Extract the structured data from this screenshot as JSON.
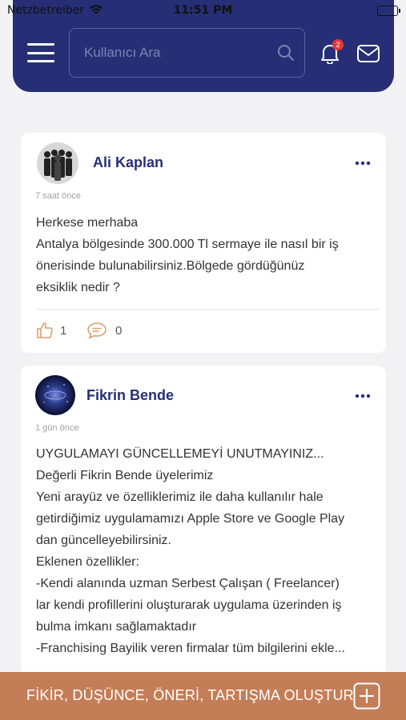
{
  "status_bar": {
    "carrier": "Netzbetreiber",
    "time": "11:51 PM"
  },
  "header": {
    "search_placeholder": "Kullanıcı Ara",
    "notification_count": "2",
    "brand_color": "#262f75"
  },
  "posts": [
    {
      "author": "Ali Kaplan",
      "time_ago": "7 saat önce",
      "lines": [
        "Herkese merhaba",
        "Antalya bölgesinde 300.000 Tl sermaye ile nasıl bir iş",
        "önerisinde bulunabilirsiniz.Bölgede gördüğünüz",
        "eksiklik nedir ?"
      ],
      "likes": "1",
      "comments": "0"
    },
    {
      "author": "Fikrin Bende",
      "time_ago": "1 gün önce",
      "lines": [
        "UYGULAMAYI GÜNCELLEMEYİ UNUTMAYINIZ...",
        "Değerli Fikrin Bende üyelerimiz",
        "Yeni arayüz ve özelliklerimiz ile daha kullanılır hale",
        "getirdiğimiz uygulamamızı Apple Store ve Google Play",
        "dan güncelleyebilirsiniz.",
        "Eklenen özellikler:",
        "-Kendi alanında uzman Serbest Çalışan ( Freelancer)",
        "lar kendi profillerini oluşturarak uygulama üzerinden iş",
        "bulma imkanı sağlamaktadır",
        "-Franchising Bayilik veren firmalar tüm bilgilerini ekle..."
      ]
    }
  ],
  "bottom_bar": {
    "label": "FİKİR, DÜŞÜNCE, ÖNERİ, TARTIŞMA OLUŞTUR",
    "color": "#c47e57"
  }
}
